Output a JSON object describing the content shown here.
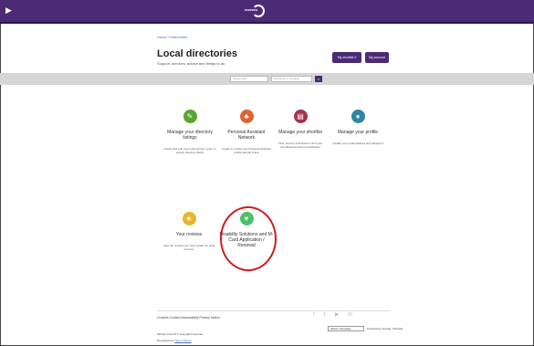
{
  "header": {
    "logo_text": "moraes"
  },
  "breadcrumb": "Home / Directories",
  "page": {
    "title": "Local directories",
    "subtitle": "Support, services, advice and things to do"
  },
  "buttons": {
    "shortlist": "My shortlist 0",
    "account": "My account"
  },
  "search": {
    "keyword_placeholder": "Keyword(s)",
    "location_placeholder": "Postcode or Location"
  },
  "cards": [
    {
      "title": "Manage your directory listings",
      "desc": "Create and edit your local service, event or activity directory listing",
      "color": "#59a632"
    },
    {
      "title": "Personal Assistant Network",
      "desc": "Create or modify your Personal Assistant profile and job listing",
      "color": "#e06233"
    },
    {
      "title": "Manage your shortlist",
      "desc": "View, amend, download or print your shortlisted services and activities",
      "color": "#a6344b"
    },
    {
      "title": "Manage your profile",
      "desc": "Update your email address and password",
      "color": "#2f86a7"
    },
    {
      "title": "Your reviews",
      "desc": "View the reviews you have written for local services",
      "color": "#e8b52a"
    },
    {
      "title": "Disability Solutions and M-Card Application / Renewal",
      "desc": "",
      "color": "#4dbf6b"
    }
  ],
  "footer": {
    "links": "Cookies   Contact   Accessibility   Privacy Notice",
    "language": "Select Language",
    "powered": "Powered by Google Translate",
    "copyright": "Moraes Council © Copyright reserved",
    "developed_by": "Developed by",
    "developer": "Open Objects"
  }
}
